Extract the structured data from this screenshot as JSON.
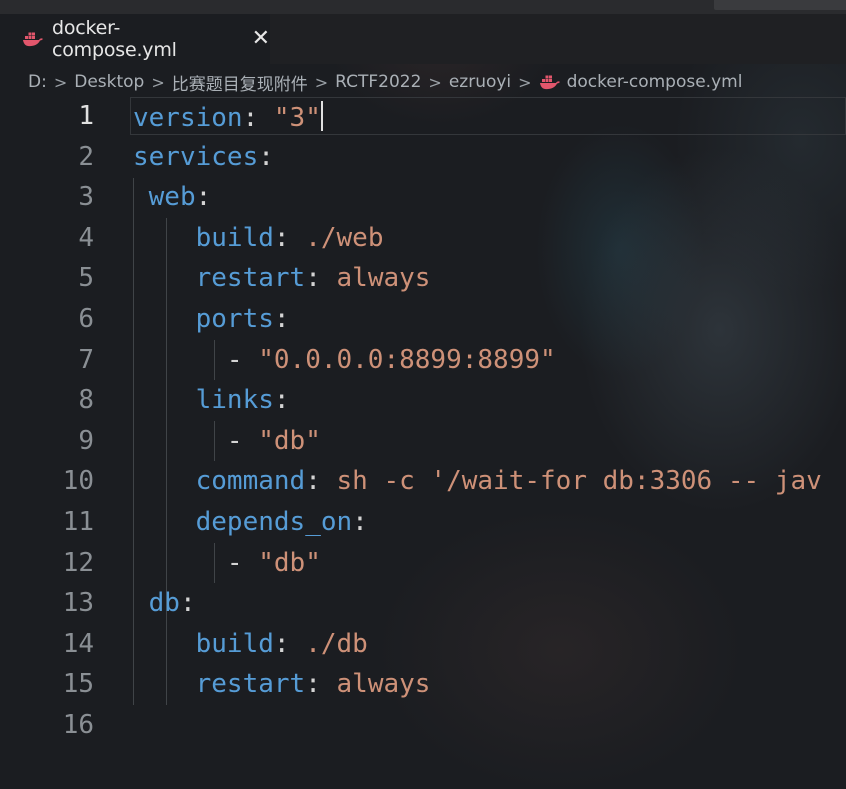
{
  "tab": {
    "icon": "docker-whale-icon",
    "label": "docker-compose.yml",
    "close": "✕"
  },
  "breadcrumb": [
    "D:",
    "Desktop",
    "比赛题目复现附件",
    "RCTF2022",
    "ezruoyi",
    "docker-compose.yml"
  ],
  "breadcrumb_sep": ">",
  "editor": {
    "active_line": 1,
    "lines": [
      {
        "n": "1",
        "indent": "",
        "key": "version",
        "sep": ": ",
        "val": "\"3\""
      },
      {
        "n": "2",
        "indent": "",
        "key": "services",
        "sep": ":",
        "val": ""
      },
      {
        "n": "3",
        "indent": " ",
        "key": "web",
        "sep": ":",
        "val": ""
      },
      {
        "n": "4",
        "indent": "    ",
        "key": "build",
        "sep": ": ",
        "val": "./web"
      },
      {
        "n": "5",
        "indent": "    ",
        "key": "restart",
        "sep": ": ",
        "val": "always"
      },
      {
        "n": "6",
        "indent": "    ",
        "key": "ports",
        "sep": ":",
        "val": ""
      },
      {
        "n": "7",
        "indent": "      ",
        "key": "",
        "sep": "- ",
        "val": "\"0.0.0.0:8899:8899\""
      },
      {
        "n": "8",
        "indent": "    ",
        "key": "links",
        "sep": ":",
        "val": ""
      },
      {
        "n": "9",
        "indent": "      ",
        "key": "",
        "sep": "- ",
        "val": "\"db\""
      },
      {
        "n": "10",
        "indent": "    ",
        "key": "command",
        "sep": ": ",
        "val": "sh -c '/wait-for db:3306 -- jav"
      },
      {
        "n": "11",
        "indent": "    ",
        "key": "depends_on",
        "sep": ":",
        "val": ""
      },
      {
        "n": "12",
        "indent": "      ",
        "key": "",
        "sep": "- ",
        "val": "\"db\""
      },
      {
        "n": "13",
        "indent": " ",
        "key": "db",
        "sep": ":",
        "val": ""
      },
      {
        "n": "14",
        "indent": "    ",
        "key": "build",
        "sep": ": ",
        "val": "./db"
      },
      {
        "n": "15",
        "indent": "    ",
        "key": "restart",
        "sep": ": ",
        "val": "always"
      },
      {
        "n": "16",
        "indent": "",
        "key": "",
        "sep": "",
        "val": ""
      }
    ]
  },
  "colors": {
    "key": "#569cd6",
    "string": "#ce9178",
    "punct": "#d4d4d4",
    "docker_icon": "#e2566c"
  }
}
